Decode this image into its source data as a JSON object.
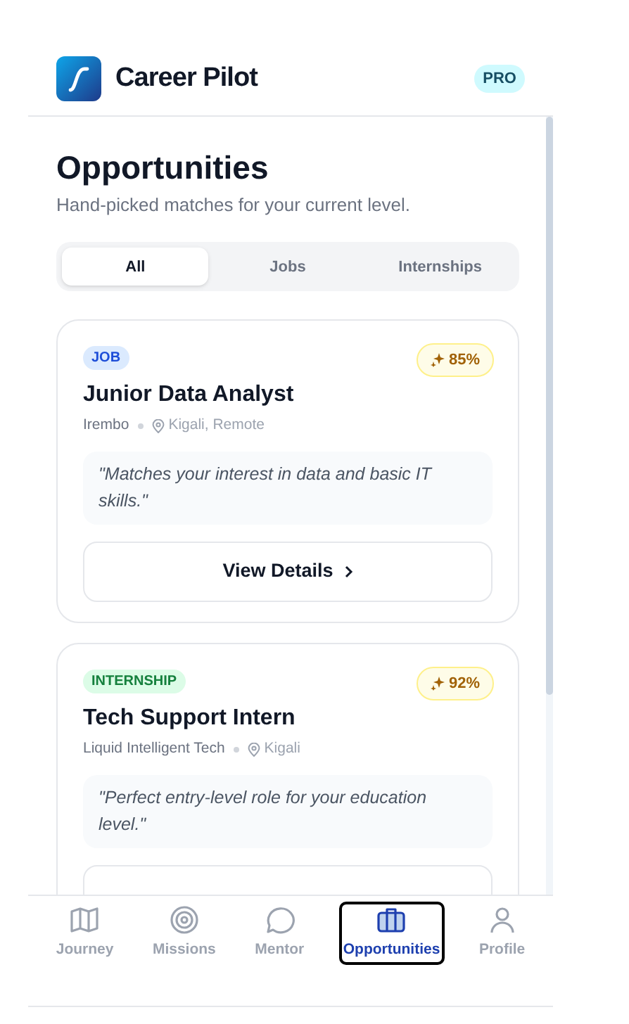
{
  "app": {
    "name": "Career Pilot",
    "badge": "PRO"
  },
  "page": {
    "title": "Opportunities",
    "subtitle": "Hand-picked matches for your current level."
  },
  "filters": [
    {
      "label": "All",
      "selected": true
    },
    {
      "label": "Jobs",
      "selected": false
    },
    {
      "label": "Internships",
      "selected": false
    }
  ],
  "opportunities": [
    {
      "kind": "job",
      "tag": "JOB",
      "match": "85%",
      "title": "Junior Data Analyst",
      "company": "Irembo",
      "location": "Kigali, Remote",
      "reason": "\"Matches your interest in data and basic IT skills.\"",
      "action": "View Details"
    },
    {
      "kind": "internship",
      "tag": "INTERNSHIP",
      "match": "92%",
      "title": "Tech Support Intern",
      "company": "Liquid Intelligent Tech",
      "location": "Kigali",
      "reason": "\"Perfect entry-level role for your education level.\""
    }
  ],
  "nav": [
    {
      "label": "Journey",
      "selected": false
    },
    {
      "label": "Missions",
      "selected": false
    },
    {
      "label": "Mentor",
      "selected": false
    },
    {
      "label": "Opportunities",
      "selected": true
    },
    {
      "label": "Profile",
      "selected": false
    }
  ]
}
